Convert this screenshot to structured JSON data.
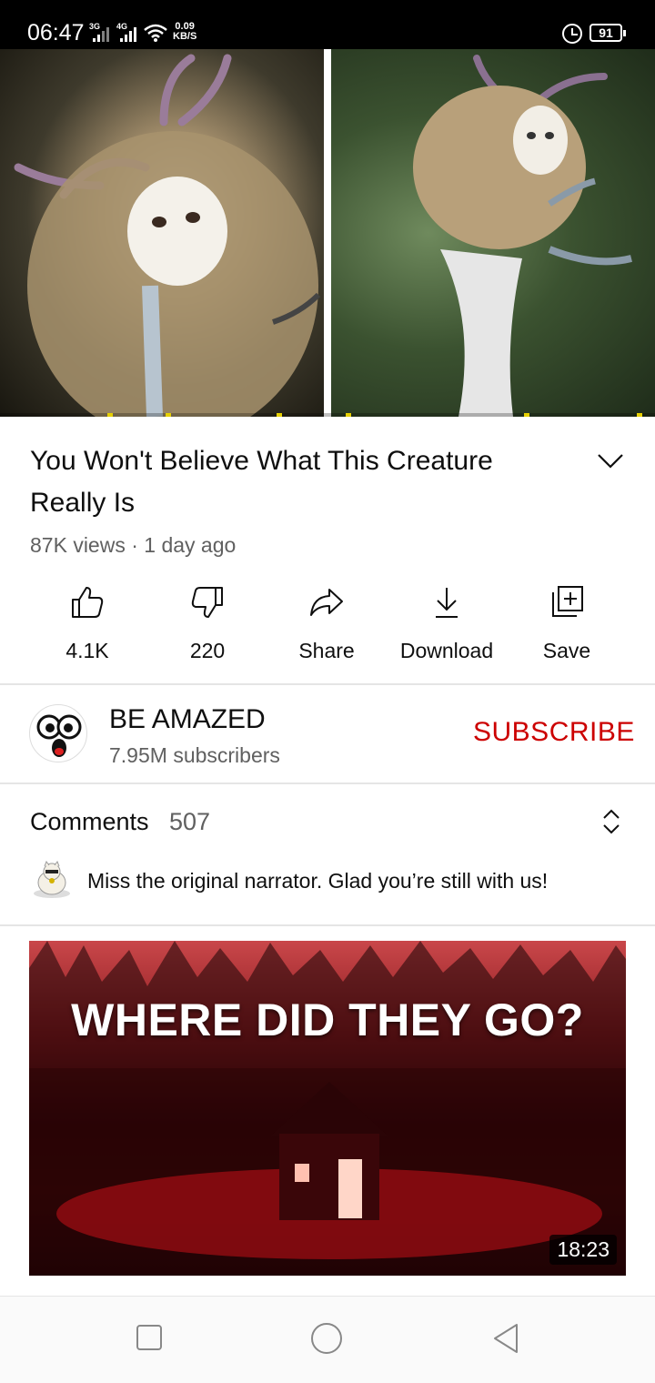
{
  "status_bar": {
    "time": "06:47",
    "signal1_tag": "3G",
    "signal2_tag": "4G",
    "speed_value": "0.09",
    "speed_unit": "KB/S",
    "battery": "91"
  },
  "player": {
    "left_thumb_icon": "owl-creature-closeup",
    "right_thumb_icon": "owl-creature-standing"
  },
  "video": {
    "title": "You Won't Believe What This Creature Really Is",
    "meta": "87K views · 1 day ago"
  },
  "actions": {
    "like": "4.1K",
    "dislike": "220",
    "share": "Share",
    "download": "Download",
    "save": "Save"
  },
  "channel": {
    "name": "BE AMAZED",
    "subscribers": "7.95M subscribers",
    "subscribe_label": "SUBSCRIBE",
    "subscribe_color": "#cc0000"
  },
  "comments": {
    "title": "Comments",
    "count": "507",
    "top_comment": "Miss the original narrator. Glad you’re still with us!"
  },
  "next_video": {
    "thumbnail_text": "WHERE DID THEY GO?",
    "duration": "18:23"
  }
}
